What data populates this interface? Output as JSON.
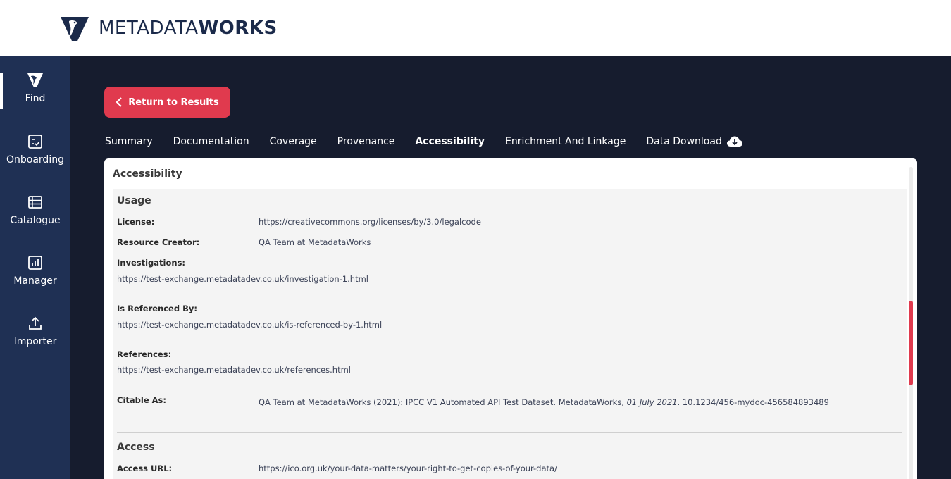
{
  "brand": {
    "name_thin": "METADATA",
    "name_bold": "WORKS"
  },
  "sidebar": {
    "items": [
      {
        "label": "Find",
        "icon": "find-logo-icon"
      },
      {
        "label": "Onboarding",
        "icon": "checklist-icon"
      },
      {
        "label": "Catalogue",
        "icon": "list-icon"
      },
      {
        "label": "Manager",
        "icon": "bar-chart-icon"
      },
      {
        "label": "Importer",
        "icon": "upload-icon"
      }
    ]
  },
  "return_button": {
    "label": "Return to Results"
  },
  "tabs": [
    {
      "label": "Summary"
    },
    {
      "label": "Documentation"
    },
    {
      "label": "Coverage"
    },
    {
      "label": "Provenance"
    },
    {
      "label": "Accessibility"
    },
    {
      "label": "Enrichment And Linkage"
    },
    {
      "label": "Data Download"
    }
  ],
  "panel": {
    "title": "Accessibility",
    "usage": {
      "title": "Usage",
      "license_label": "License:",
      "license_value": "https://creativecommons.org/licenses/by/3.0/legalcode",
      "creator_label": "Resource Creator:",
      "creator_value": "QA Team at MetadataWorks",
      "investigations_label": "Investigations:",
      "investigations_value": "https://test-exchange.metadatadev.co.uk/investigation-1.html",
      "referenced_by_label": "Is Referenced By:",
      "referenced_by_value": "https://test-exchange.metadatadev.co.uk/is-referenced-by-1.html",
      "references_label": "References:",
      "references_value": "https://test-exchange.metadatadev.co.uk/references.html",
      "citable_label": "Citable As:",
      "citable_prefix": "QA Team at MetadataWorks (2021): IPCC V1 Automated API Test Dataset. MetadataWorks, ",
      "citable_date": "01 July 2021",
      "citable_suffix": ". 10.1234/456-mydoc-456584893489"
    },
    "access": {
      "title": "Access",
      "url_label": "Access URL:",
      "url_value": "https://ico.org.uk/your-data-matters/your-right-to-get-copies-of-your-data/"
    }
  },
  "colors": {
    "sidebar_bg": "#1f3054",
    "main_bg": "#161c2e",
    "accent_red": "#e03a4e",
    "brand_navy": "#1b2a4a"
  }
}
